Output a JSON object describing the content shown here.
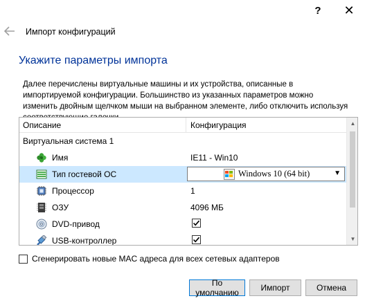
{
  "window": {
    "help_glyph": "?",
    "close_glyph": "✕"
  },
  "nav": {
    "title": "Импорт конфигураций"
  },
  "page": {
    "heading": "Укажите параметры импорта",
    "description": "Далее перечислены виртуальные машины и их устройства, описанные в импортируемой конфигурации. Большинство из указанных параметров можно изменить двойным щелчком мыши на выбранном элементе, либо отключить используя соответствующие галочки."
  },
  "table": {
    "columns": [
      "Описание",
      "Конфигурация"
    ],
    "group": "Виртуальная система 1",
    "rows": [
      {
        "label": "Имя",
        "value": "IE11 - Win10",
        "icon": "name-icon"
      },
      {
        "label": "Тип гостевой ОС",
        "value": "Windows 10 (64 bit)",
        "icon": "os-type-icon",
        "selected": true
      },
      {
        "label": "Процессор",
        "value": "1",
        "icon": "cpu-icon"
      },
      {
        "label": "ОЗУ",
        "value": "4096 МБ",
        "icon": "ram-icon"
      },
      {
        "label": "DVD-привод",
        "checked": true,
        "icon": "dvd-icon"
      },
      {
        "label": "USB-контроллер",
        "checked": true,
        "icon": "usb-icon"
      }
    ]
  },
  "options": {
    "mac_label": "Сгенерировать новые MAC адреса для всех сетевых адаптеров",
    "mac_checked": false
  },
  "buttons": {
    "default": "По умолчанию",
    "import": "Импорт",
    "cancel": "Отмена"
  },
  "colors": {
    "heading": "#003399",
    "selected_row": "#cce8ff",
    "default_button_border": "#0078d7"
  }
}
